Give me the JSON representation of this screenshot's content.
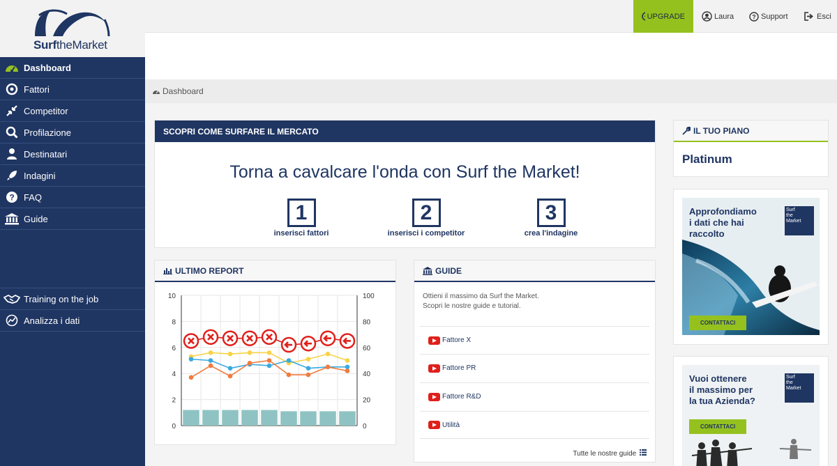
{
  "logo": {
    "brand_bold": "Surf",
    "brand_rest": "theMarket"
  },
  "nav": {
    "items": [
      {
        "label": "Dashboard"
      },
      {
        "label": "Fattori"
      },
      {
        "label": "Competitor"
      },
      {
        "label": "Profilazione"
      },
      {
        "label": "Destinatari"
      },
      {
        "label": "Indagini"
      },
      {
        "label": "FAQ"
      },
      {
        "label": "Guide"
      }
    ],
    "lower": [
      {
        "label": "Training on the job"
      },
      {
        "label": "Analizza i dati"
      }
    ]
  },
  "topbar": {
    "upgrade": "UPGRADE",
    "user": "Laura",
    "support": "Support",
    "logout": "Esci"
  },
  "breadcrumb": "Dashboard",
  "hero": {
    "header": "SCOPRI COME SURFARE IL MERCATO",
    "title": "Torna a cavalcare l'onda con Surf the Market!",
    "steps": [
      {
        "num": "1",
        "caption": "inserisci fattori"
      },
      {
        "num": "2",
        "caption": "inserisci i competitor"
      },
      {
        "num": "3",
        "caption": "crea l'indagine"
      }
    ]
  },
  "report": {
    "header": "ULTIMO REPORT"
  },
  "guide": {
    "header": "GUIDE",
    "intro1": "Ottieni il massimo da Surf the Market.",
    "intro2": "Scopri le nostre guide e tutorial.",
    "items": [
      "Fattore X",
      "Fattore PR",
      "Fattore R&D",
      "Utilità"
    ],
    "all": "Tutte le nostre guide"
  },
  "plan": {
    "header": "IL TUO PIANO",
    "name": "Platinum"
  },
  "ads": [
    {
      "line1": "Approfondiamo",
      "line2": "i dati che hai",
      "line3": "raccolto",
      "button": "CONTATTACI",
      "logo_top": "Surf",
      "logo_mid": "the",
      "logo_bot": "Market"
    },
    {
      "line1": "Vuoi ottenere",
      "line2": "il massimo per",
      "line3": "la tua Azienda?",
      "button": "CONTATTACI",
      "logo_top": "Surf",
      "logo_mid": "the",
      "logo_bot": "Market"
    }
  ],
  "colors": {
    "navy": "#1f3562",
    "green": "#95c11f",
    "red": "#e0201b",
    "orange": "#f07b3f",
    "yellow": "#f7d348",
    "blue": "#3aa9e0",
    "teal": "#8fc3c3"
  },
  "chart_data": {
    "type": "line",
    "left_axis": {
      "ticks": [
        0,
        2,
        4,
        6,
        8,
        10
      ],
      "ylim": [
        0,
        10
      ]
    },
    "right_axis": {
      "ticks": [
        0,
        20,
        40,
        60,
        80,
        100
      ],
      "ylim": [
        0,
        100
      ]
    },
    "x": [
      1,
      2,
      3,
      4,
      5,
      6,
      7,
      8,
      9
    ],
    "series": [
      {
        "color": "#e0201b",
        "axis": "right",
        "values": [
          65,
          68,
          67,
          67,
          68,
          62,
          63,
          67,
          65
        ],
        "markers": [
          "x",
          "x",
          "x",
          "x",
          "x",
          "arrow-left",
          "arrow-left",
          "arrow-left",
          "arrow-left"
        ]
      },
      {
        "color": "#f7d348",
        "axis": "left",
        "values": [
          5.3,
          5.6,
          5.5,
          5.6,
          5.6,
          4.8,
          5.1,
          5.5,
          5.0
        ]
      },
      {
        "color": "#3aa9e0",
        "axis": "left",
        "values": [
          5.1,
          5.0,
          4.4,
          4.7,
          4.6,
          5.0,
          4.4,
          4.5,
          4.5
        ]
      },
      {
        "color": "#f07b3f",
        "axis": "left",
        "values": [
          3.7,
          4.6,
          3.8,
          4.8,
          5.0,
          3.9,
          3.9,
          4.5,
          4.2
        ]
      },
      {
        "color": "#8fc3c3",
        "axis": "left",
        "type": "bar",
        "values": [
          1.2,
          1.2,
          1.2,
          1.2,
          1.2,
          1.1,
          1.1,
          1.1,
          1.1
        ]
      }
    ]
  }
}
